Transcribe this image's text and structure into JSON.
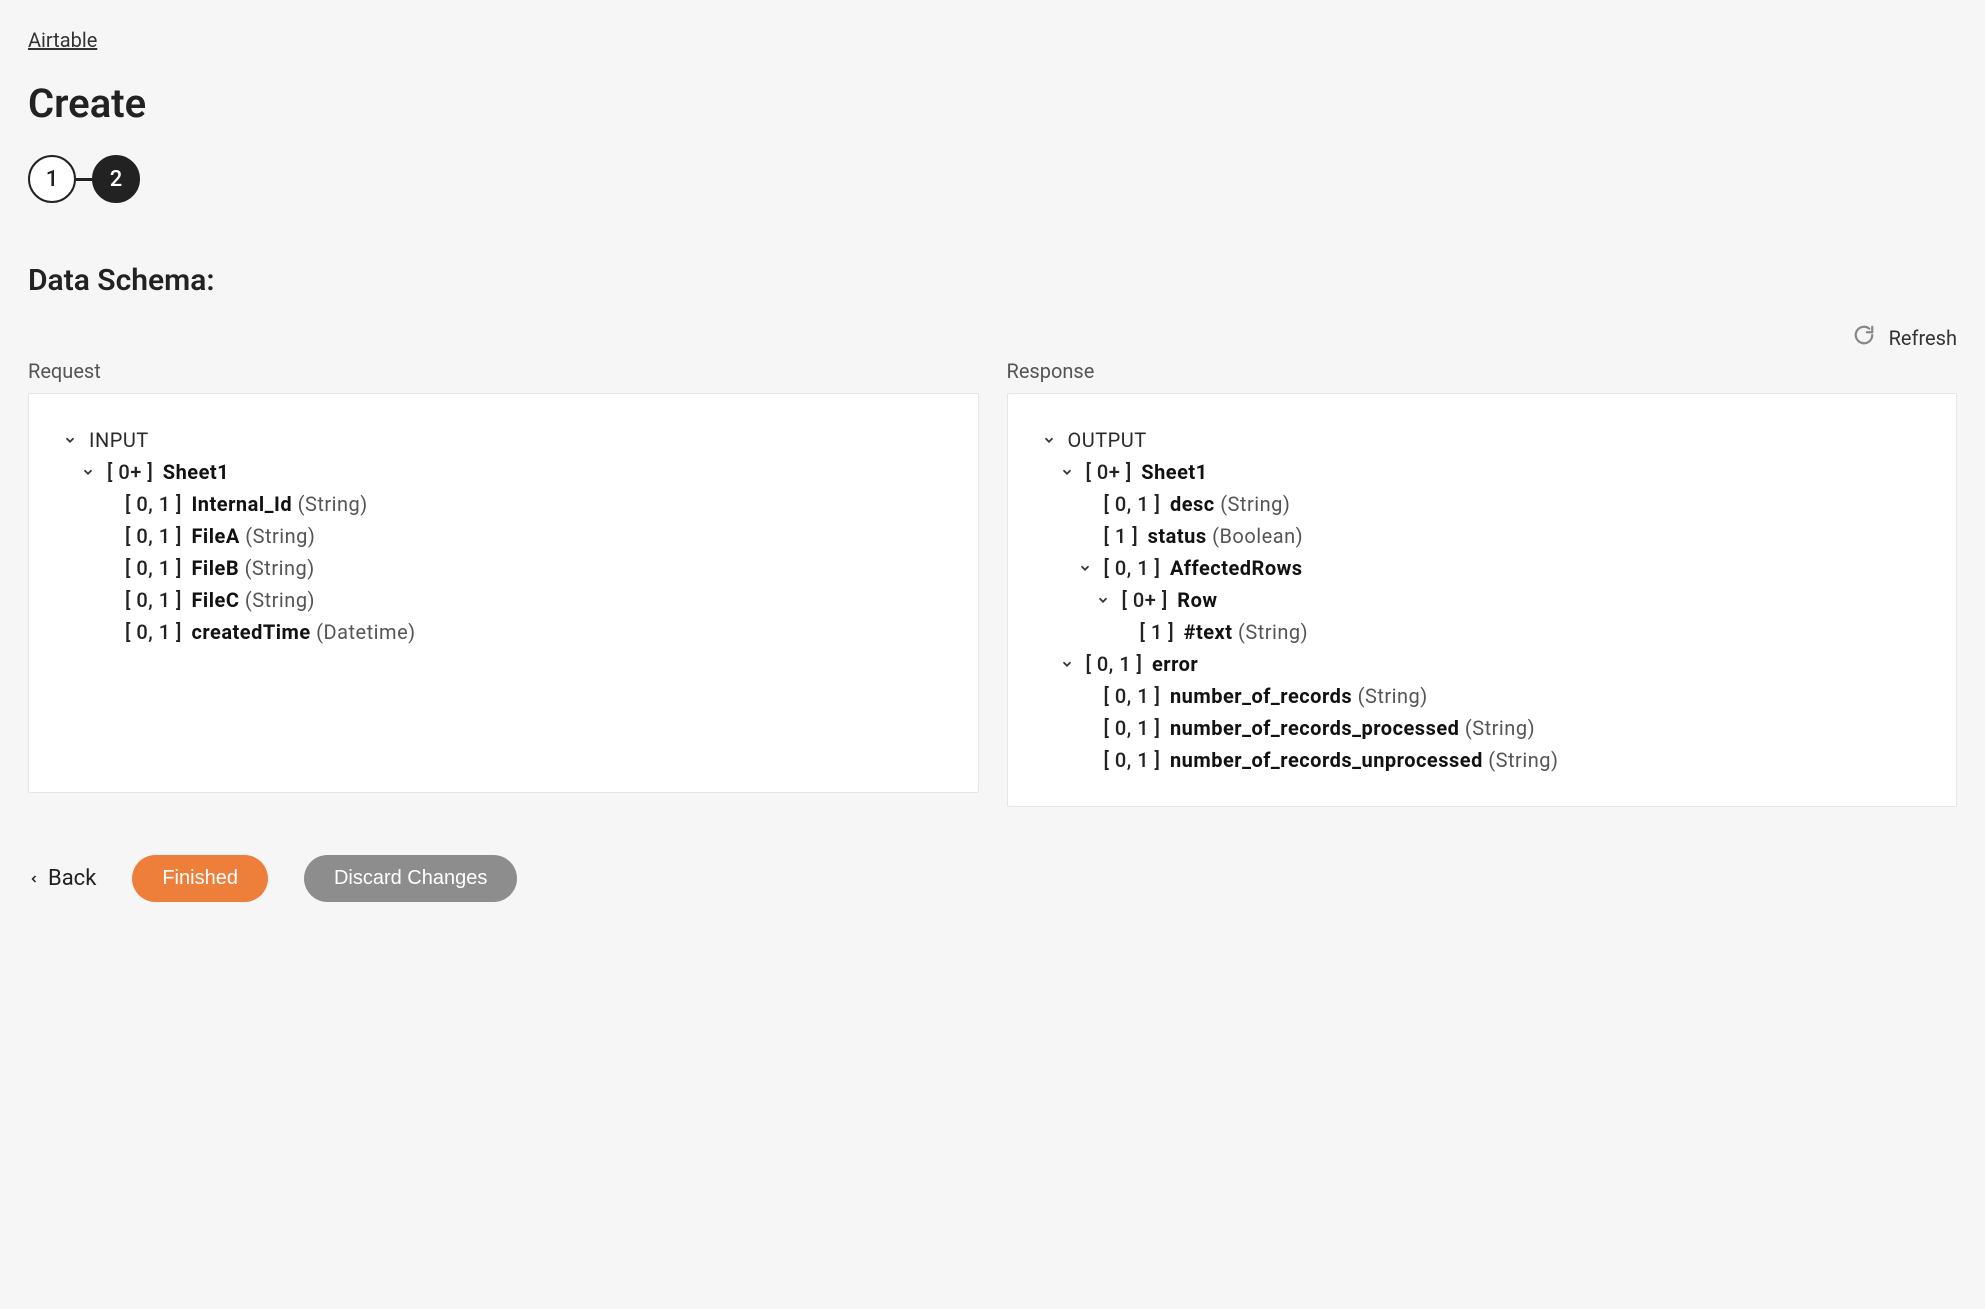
{
  "breadcrumb": {
    "label": "Airtable"
  },
  "page": {
    "title": "Create"
  },
  "stepper": {
    "steps": [
      "1",
      "2"
    ],
    "activeIndex": 1
  },
  "section": {
    "title": "Data Schema:"
  },
  "refresh": {
    "label": "Refresh"
  },
  "panels": {
    "request": {
      "label": "Request",
      "root": "INPUT",
      "tree": [
        {
          "indent": 1,
          "expandable": true,
          "cardinality": "[ 0+ ]",
          "name": "Sheet1",
          "type": ""
        },
        {
          "indent": 2,
          "expandable": false,
          "cardinality": "[ 0, 1 ]",
          "name": "Internal_Id",
          "type": "(String)"
        },
        {
          "indent": 2,
          "expandable": false,
          "cardinality": "[ 0, 1 ]",
          "name": "FileA",
          "type": "(String)"
        },
        {
          "indent": 2,
          "expandable": false,
          "cardinality": "[ 0, 1 ]",
          "name": "FileB",
          "type": "(String)"
        },
        {
          "indent": 2,
          "expandable": false,
          "cardinality": "[ 0, 1 ]",
          "name": "FileC",
          "type": "(String)"
        },
        {
          "indent": 2,
          "expandable": false,
          "cardinality": "[ 0, 1 ]",
          "name": "createdTime",
          "type": "(Datetime)"
        }
      ]
    },
    "response": {
      "label": "Response",
      "root": "OUTPUT",
      "tree": [
        {
          "indent": 1,
          "expandable": true,
          "cardinality": "[ 0+ ]",
          "name": "Sheet1",
          "type": ""
        },
        {
          "indent": 2,
          "expandable": false,
          "cardinality": "[ 0, 1 ]",
          "name": "desc",
          "type": "(String)"
        },
        {
          "indent": 2,
          "expandable": false,
          "cardinality": "[ 1 ]",
          "name": "status",
          "type": "(Boolean)"
        },
        {
          "indent": 2,
          "expandable": true,
          "cardinality": "[ 0, 1 ]",
          "name": "AffectedRows",
          "type": ""
        },
        {
          "indent": 3,
          "expandable": true,
          "cardinality": "[ 0+ ]",
          "name": "Row",
          "type": ""
        },
        {
          "indent": 4,
          "expandable": false,
          "cardinality": "[ 1 ]",
          "name": "#text",
          "type": "(String)"
        },
        {
          "indent": 1,
          "expandable": true,
          "cardinality": "[ 0, 1 ]",
          "name": "error",
          "type": ""
        },
        {
          "indent": 2,
          "expandable": false,
          "cardinality": "[ 0, 1 ]",
          "name": "number_of_records",
          "type": "(String)"
        },
        {
          "indent": 2,
          "expandable": false,
          "cardinality": "[ 0, 1 ]",
          "name": "number_of_records_processed",
          "type": "(String)"
        },
        {
          "indent": 2,
          "expandable": false,
          "cardinality": "[ 0, 1 ]",
          "name": "number_of_records_unprocessed",
          "type": "(String)"
        }
      ]
    }
  },
  "footer": {
    "back": "Back",
    "finished": "Finished",
    "discard": "Discard Changes"
  }
}
